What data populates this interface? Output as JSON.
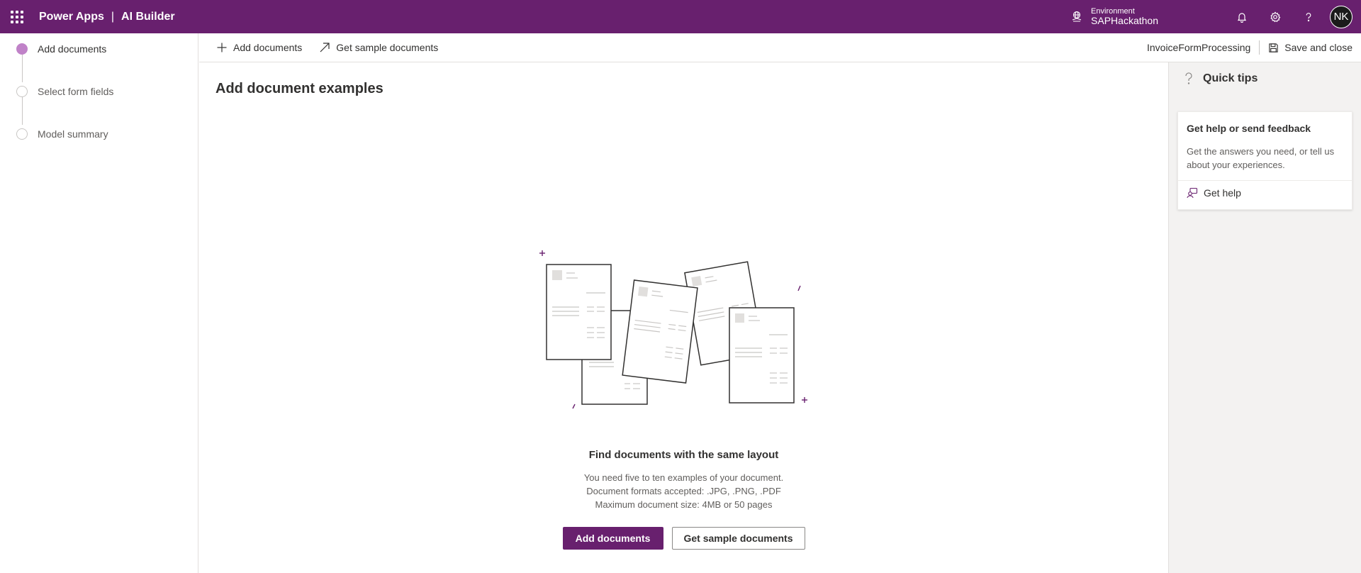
{
  "topbar": {
    "app_name": "Power Apps",
    "separator": "|",
    "product_name": "AI Builder",
    "environment_label": "Environment",
    "environment_name": "SAPHackathon",
    "avatar_initials": "NK",
    "brand_color": "#68206e"
  },
  "steps": [
    {
      "label": "Add documents",
      "state": "active"
    },
    {
      "label": "Select form fields",
      "state": "inactive"
    },
    {
      "label": "Model summary",
      "state": "inactive"
    }
  ],
  "commandbar": {
    "add_documents": "Add documents",
    "get_sample_documents": "Get sample documents",
    "model_name": "InvoiceFormProcessing",
    "save_and_close": "Save and close"
  },
  "main": {
    "title": "Add document examples",
    "find_title": "Find documents with the same layout",
    "desc_line1": "You need five to ten examples of your document.",
    "desc_line2": "Document formats accepted: .JPG, .PNG, .PDF",
    "desc_line3": "Maximum document size: 4MB or 50 pages",
    "primary_button": "Add documents",
    "secondary_button": "Get sample documents"
  },
  "quick_tips": {
    "title": "Quick tips",
    "card_title": "Get help or send feedback",
    "card_body": "Get the answers you need, or tell us about your experiences.",
    "card_link": "Get help"
  }
}
